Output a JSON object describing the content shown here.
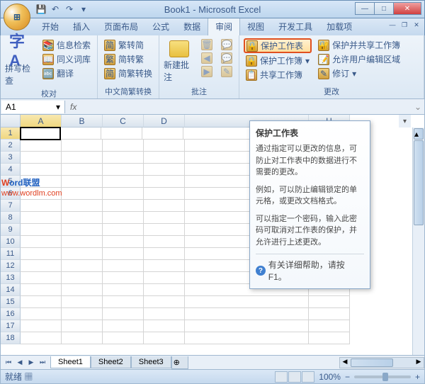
{
  "window": {
    "title": "Book1 - Microsoft Excel"
  },
  "tabs": {
    "t0": "开始",
    "t1": "插入",
    "t2": "页面布局",
    "t3": "公式",
    "t4": "数据",
    "t5": "审阅",
    "t6": "视图",
    "t7": "开发工具",
    "t8": "加载项"
  },
  "ribbon": {
    "proof": {
      "title": "校对",
      "spell": "拼写检查",
      "research": "信息检索",
      "thesaurus": "同义词库",
      "translate": "翻译"
    },
    "cc": {
      "title": "中文简繁转换",
      "to_trad": "繁转简",
      "to_simp": "简转繁",
      "convert": "简繁转换"
    },
    "comments": {
      "title": "批注",
      "new": "新建批注"
    },
    "changes": {
      "title": "更改",
      "protect_sheet": "保护工作表",
      "protect_wb": "保护工作簿",
      "share_wb": "共享工作簿",
      "protect_share": "保护并共享工作簿",
      "allow_ranges": "允许用户编辑区域",
      "track": "修订"
    }
  },
  "namebox": "A1",
  "columns": [
    "A",
    "B",
    "C",
    "D",
    "",
    "",
    "",
    "H"
  ],
  "rows": [
    "1",
    "2",
    "3",
    "4",
    "5",
    "6",
    "7",
    "8",
    "9",
    "10",
    "11",
    "12",
    "13",
    "14",
    "15",
    "16",
    "17",
    "18"
  ],
  "tooltip": {
    "title": "保护工作表",
    "p1": "通过指定可以更改的信息，可防止对工作表中的数据进行不需要的更改。",
    "p2": "例如，可以防止编辑锁定的单元格，或更改文档格式。",
    "p3": "可以指定一个密码，输入此密码可取消对工作表的保护，并允许进行上述更改。",
    "help": "有关详细帮助，请按 F1。"
  },
  "sheets": {
    "s1": "Sheet1",
    "s2": "Sheet2",
    "s3": "Sheet3"
  },
  "status": {
    "ready": "就绪",
    "zoom": "100%"
  },
  "watermark": {
    "brand_w": "W",
    "brand_rest": "ord联盟",
    "url": "www.wordlm.com"
  }
}
